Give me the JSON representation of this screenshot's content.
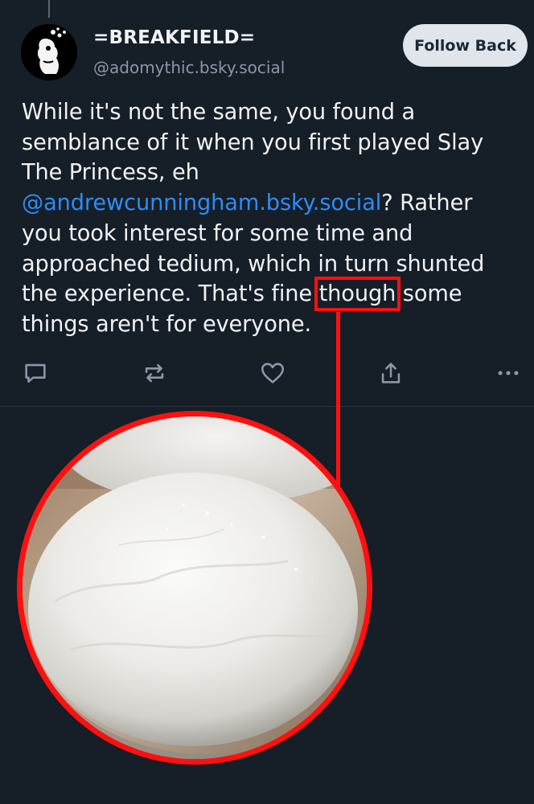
{
  "post": {
    "author": {
      "display_name": "=BREAKFIELD=",
      "handle": "@adomythic.bsky.social"
    },
    "follow_label": "Follow Back",
    "text_part1": "While it's not the same, you found a semblance of it when you first played Slay The Princess, eh ",
    "mention": "@andrewcunningham.bsky.social",
    "text_part2": "? Rather you took interest for some time and approached tedium, which in turn shunted the experience. That's fine ",
    "highlighted_word": "though",
    "text_part3": "  some things aren't for everyone."
  },
  "actions": {
    "reply_icon": "reply-icon",
    "repost_icon": "repost-icon",
    "like_icon": "heart-icon",
    "share_icon": "share-icon",
    "more_icon": "more-icon"
  },
  "colors": {
    "background": "#161e27",
    "text": "#f1f3f5",
    "mention": "#2f8cf4",
    "handle": "#8b98a8",
    "annotation_red": "#ff1010",
    "follow_button_bg": "#dfe5eb"
  }
}
